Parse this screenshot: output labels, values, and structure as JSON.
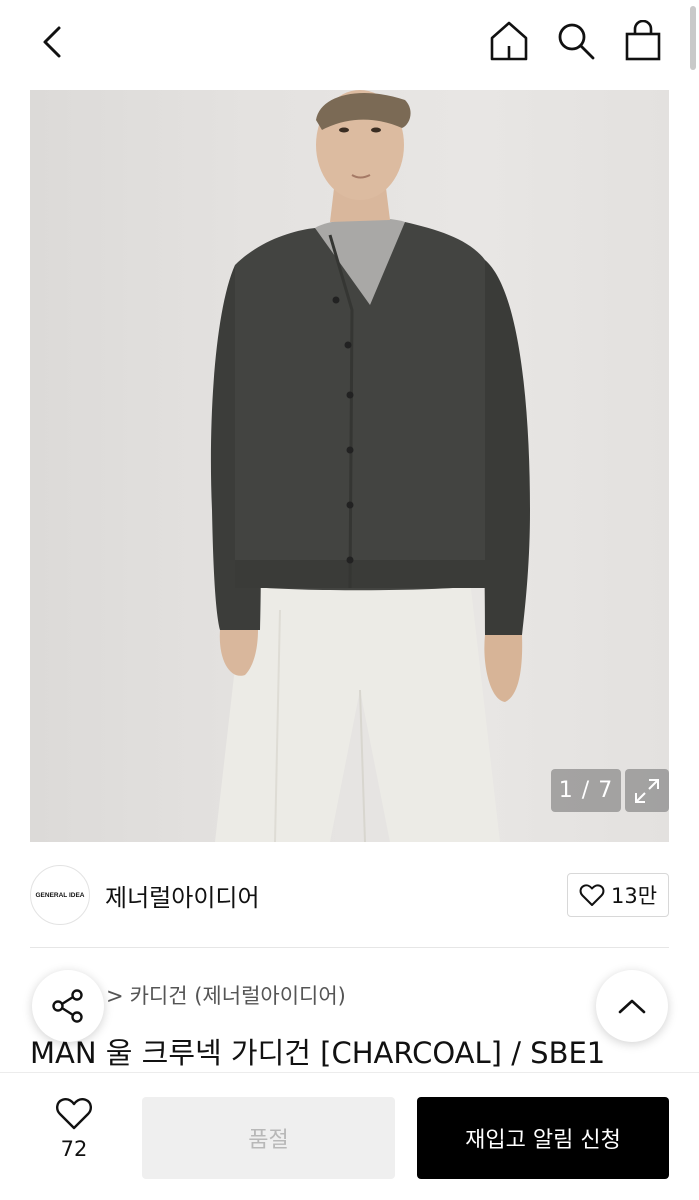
{
  "header": {
    "back_icon": "chevron-left-icon",
    "home_icon": "home-icon",
    "search_icon": "search-icon",
    "cart_icon": "shopping-bag-icon"
  },
  "gallery": {
    "counter": "1 / 7",
    "expand_icon": "expand-icon"
  },
  "brand": {
    "logo_text": "GENERAL IDEA",
    "name": "제너럴아이디어",
    "like_count": "13만"
  },
  "breadcrumb": {
    "items": [
      "카디건 (제너럴아이디어)"
    ]
  },
  "product": {
    "title": "MAN 울 크루넥 가디건 [CHARCOAL] / SBE1"
  },
  "actions": {
    "share_icon": "share-icon",
    "top_icon": "chevron-up-icon"
  },
  "bottom_bar": {
    "wish_count": "72",
    "soldout_label": "품절",
    "restock_label": "재입고 알림 신청"
  }
}
